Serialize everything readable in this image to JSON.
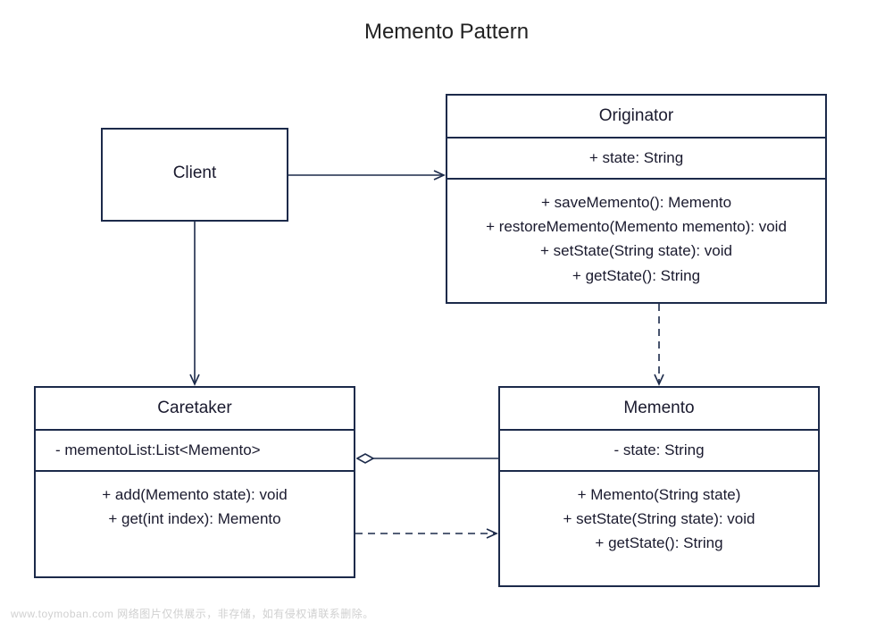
{
  "title": "Memento Pattern",
  "client": {
    "name": "Client"
  },
  "originator": {
    "name": "Originator",
    "attributes": "+   state: String",
    "methods": [
      "+  saveMemento(): Memento",
      "+  restoreMemento(Memento memento): void",
      "+   setState(String state):  void",
      "+   getState(): String"
    ]
  },
  "caretaker": {
    "name": "Caretaker",
    "attributes": "-   mementoList:List<Memento>",
    "methods": [
      "+   add(Memento state): void",
      "+   get(int index): Memento"
    ]
  },
  "memento": {
    "name": "Memento",
    "attributes": "-   state: String",
    "methods": [
      "+   Memento(String state)",
      "+   setState(String state):  void",
      "+   getState(): String"
    ]
  },
  "relationships": [
    {
      "from": "Client",
      "to": "Originator",
      "type": "association-arrow"
    },
    {
      "from": "Client",
      "to": "Caretaker",
      "type": "association-arrow"
    },
    {
      "from": "Originator",
      "to": "Memento",
      "type": "dependency-arrow-dashed"
    },
    {
      "from": "Caretaker",
      "to": "Memento",
      "type": "aggregation-diamond"
    },
    {
      "from": "Caretaker",
      "to": "Memento",
      "type": "dependency-arrow-dashed"
    }
  ],
  "watermark": "www.toymoban.com  网络图片仅供展示，非存储，如有侵权请联系删除。"
}
